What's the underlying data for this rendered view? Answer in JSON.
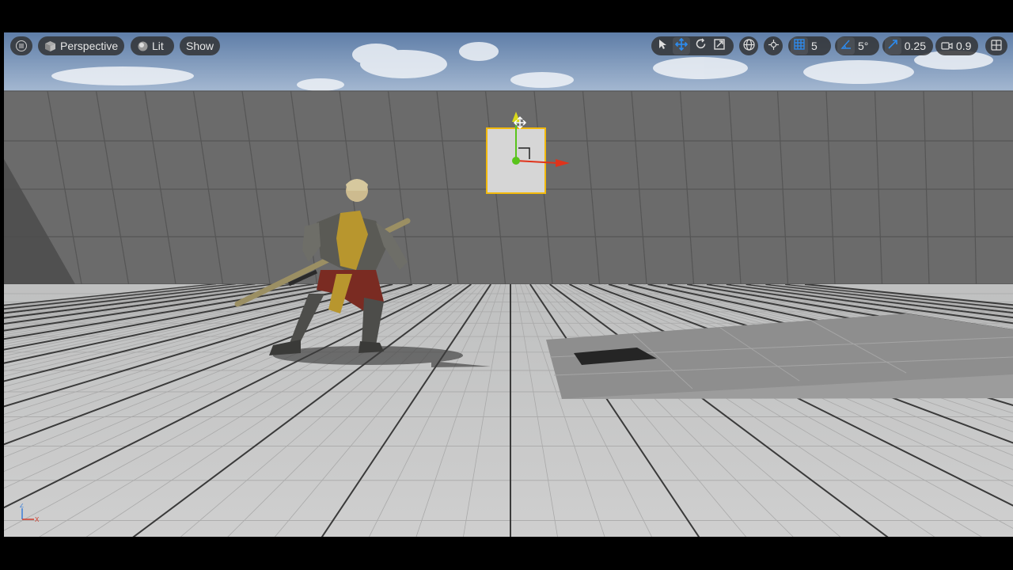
{
  "toolbar": {
    "menu_icon": "hamburger-menu-icon",
    "perspective_label": "Perspective",
    "lit_label": "Lit",
    "show_label": "Show",
    "grid_snap_value": "5",
    "rotation_snap_value": "5°",
    "scale_snap_value": "0.25",
    "camera_speed_value": "0.9"
  },
  "icons": {
    "select": "cursor-icon",
    "translate": "move-arrows-icon",
    "rotate": "rotate-icon",
    "scale": "scale-icon",
    "world_space": "globe-icon",
    "surface_snap": "surface-snap-icon",
    "grid_snap": "grid-icon",
    "rotation_snap": "angle-icon",
    "scale_snap": "scale-arrow-icon",
    "camera": "camera-icon",
    "layout": "viewport-layout-icon"
  },
  "axis_indicator": {
    "z": "Z",
    "x": "X"
  },
  "colors": {
    "toolbar_bg": "#303030",
    "active_blue": "#2d8cf0",
    "gizmo_x": "#e0331b",
    "gizmo_y": "#59c41b",
    "gizmo_z": "#d9d91a",
    "selection_outline": "#f2b90c"
  }
}
